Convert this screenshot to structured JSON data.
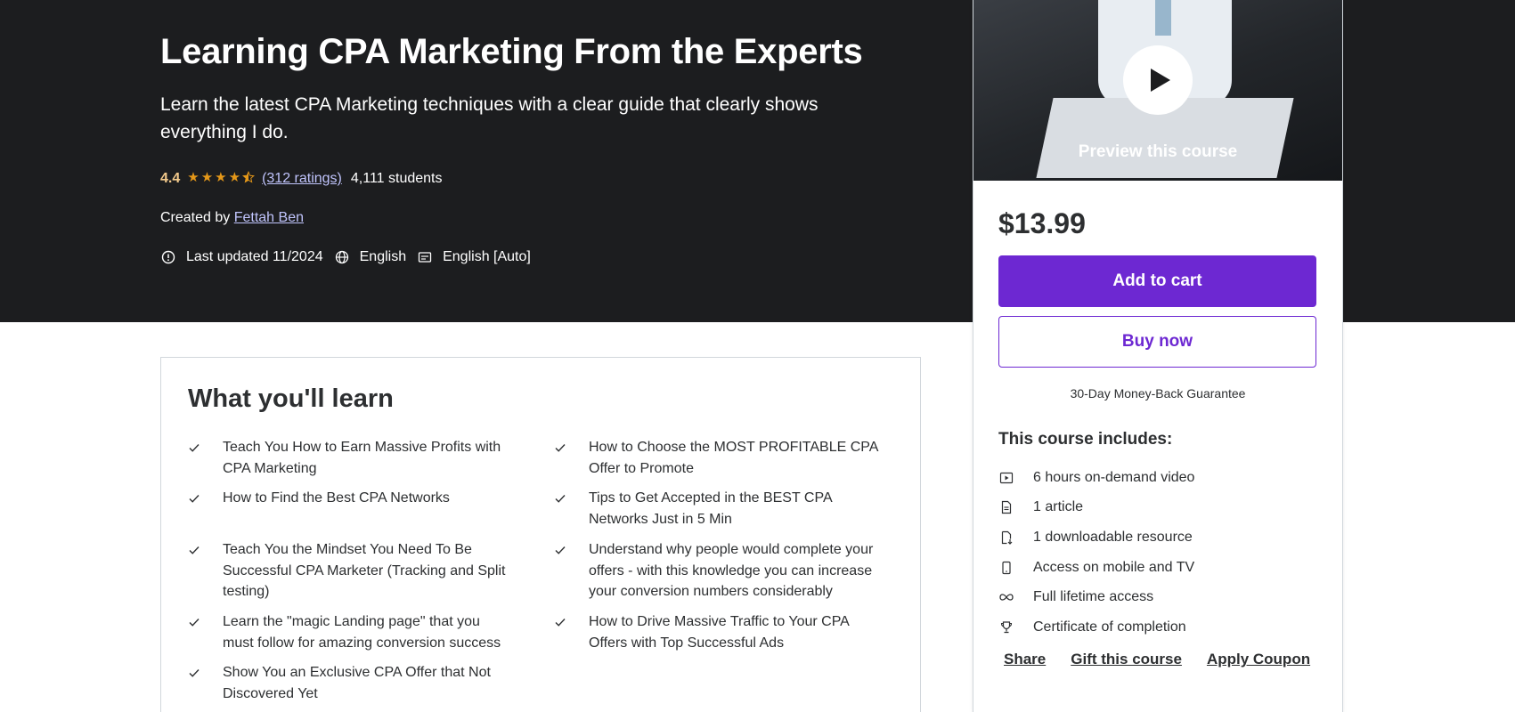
{
  "course": {
    "title": "Learning CPA Marketing From the Experts",
    "subtitle": "Learn the latest CPA Marketing techniques with a clear guide that clearly shows everything I do.",
    "rating": "4.4",
    "stars_filled": 4.5,
    "ratings_text": "(312 ratings)",
    "students": "4,111 students",
    "created_by_label": "Created by",
    "author": "Fettah Ben",
    "last_updated": "Last updated 11/2024",
    "language": "English",
    "captions": "English [Auto]"
  },
  "learn": {
    "title": "What you'll learn",
    "items": [
      "Teach You How to Earn Massive Profits with CPA Marketing",
      "How to Choose the MOST PROFITABLE CPA Offer to Promote",
      "How to Find the Best CPA Networks",
      "Tips to Get Accepted in the BEST CPA Networks Just in 5 Min",
      "Teach You the Mindset You Need To Be Successful CPA Marketer (Tracking and Split testing)",
      "Understand why people would complete your offers - with this knowledge you can increase your conversion numbers considerably",
      "Learn the \"magic Landing page\" that you must follow for amazing conversion success",
      "How to Drive Massive Traffic to Your CPA Offers with Top Successful Ads",
      "Show You an Exclusive CPA Offer that Not Discovered Yet"
    ]
  },
  "sidebar": {
    "preview_label": "Preview this course",
    "price": "$13.99",
    "add_to_cart": "Add to cart",
    "buy_now": "Buy now",
    "guarantee": "30-Day Money-Back Guarantee",
    "includes_title": "This course includes:",
    "includes": [
      {
        "icon": "video-icon",
        "text": "6 hours on-demand video"
      },
      {
        "icon": "article-icon",
        "text": "1 article"
      },
      {
        "icon": "download-icon",
        "text": "1 downloadable resource"
      },
      {
        "icon": "mobile-icon",
        "text": "Access on mobile and TV"
      },
      {
        "icon": "infinity-icon",
        "text": "Full lifetime access"
      },
      {
        "icon": "trophy-icon",
        "text": "Certificate of completion"
      }
    ],
    "links": {
      "share": "Share",
      "gift": "Gift this course",
      "coupon": "Apply Coupon"
    }
  },
  "colors": {
    "hero_bg": "#1c1d1f",
    "accent": "#6d28d2",
    "rating": "#f3ca8c",
    "link": "#c0c4fc"
  }
}
